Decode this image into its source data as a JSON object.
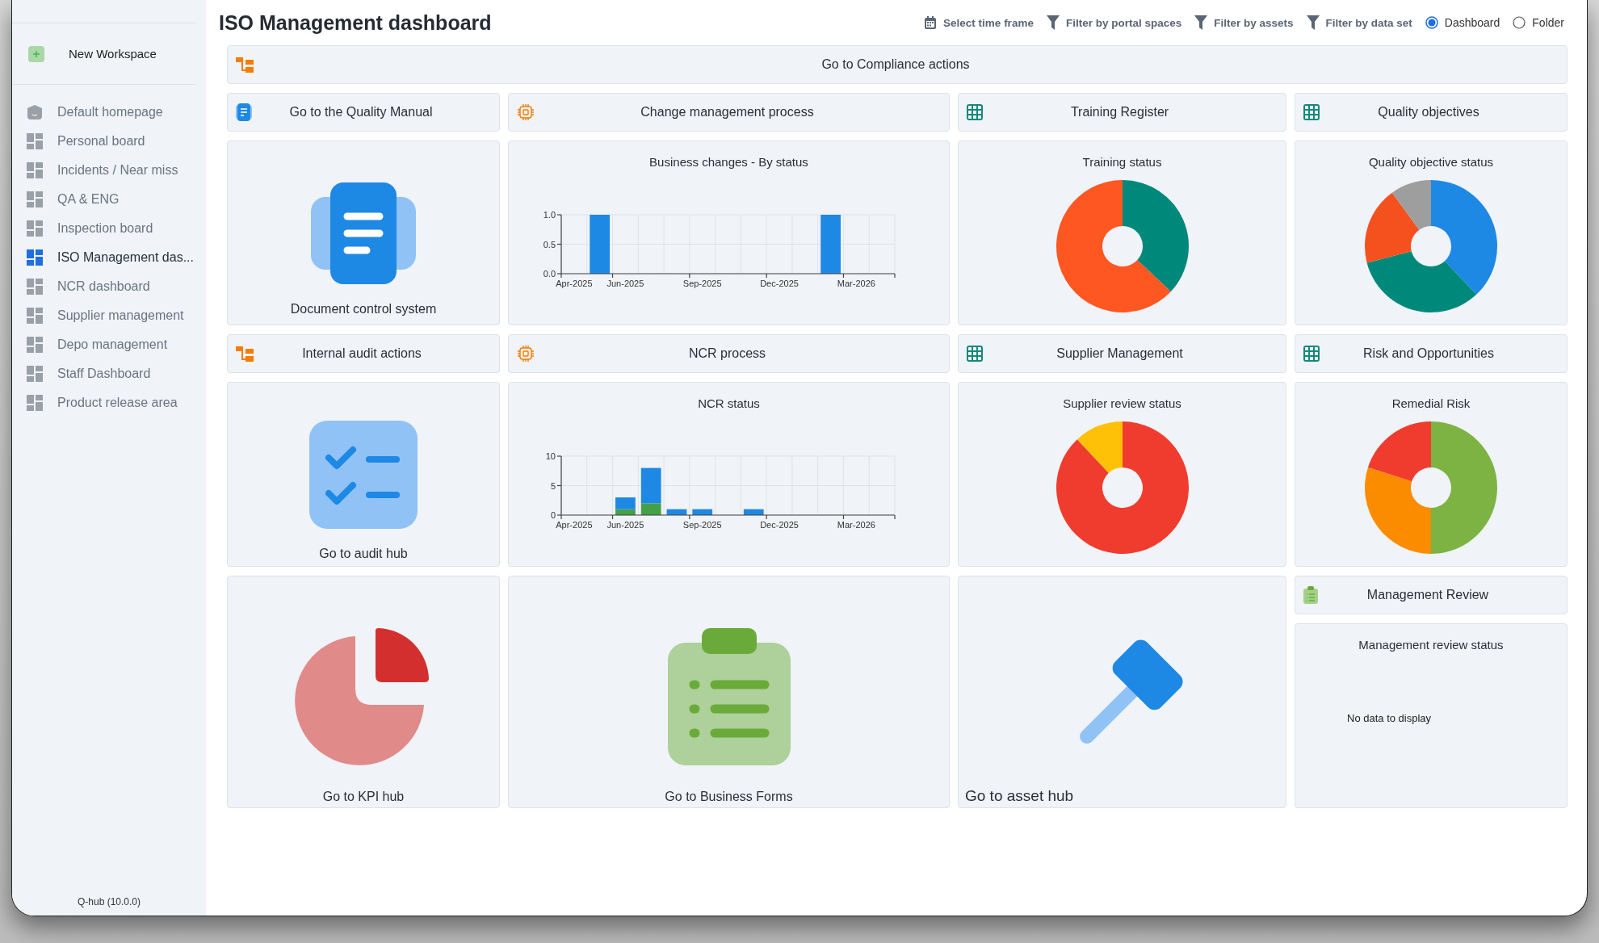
{
  "sidebar": {
    "new_workspace": "New Workspace",
    "items": [
      {
        "label": "Default homepage",
        "kind": "home",
        "selected": false
      },
      {
        "label": "Personal board",
        "kind": "board",
        "selected": false
      },
      {
        "label": "Incidents / Near miss",
        "kind": "board",
        "selected": false
      },
      {
        "label": "QA & ENG",
        "kind": "board",
        "selected": false
      },
      {
        "label": "Inspection board",
        "kind": "board",
        "selected": false
      },
      {
        "label": "ISO Management das...",
        "kind": "board",
        "selected": true
      },
      {
        "label": "NCR dashboard",
        "kind": "board",
        "selected": false
      },
      {
        "label": "Supplier management",
        "kind": "board",
        "selected": false
      },
      {
        "label": "Depo management",
        "kind": "board",
        "selected": false
      },
      {
        "label": "Staff Dashboard",
        "kind": "board",
        "selected": false
      },
      {
        "label": "Product release area",
        "kind": "board",
        "selected": false
      }
    ],
    "version": "Q-hub (10.0.0)"
  },
  "header": {
    "title": "ISO Management dashboard",
    "filters": [
      {
        "label": "Select time frame",
        "kind": "calendar"
      },
      {
        "label": "Filter by portal spaces",
        "kind": "funnel"
      },
      {
        "label": "Filter by assets",
        "kind": "funnel"
      },
      {
        "label": "Filter by data set",
        "kind": "funnel"
      }
    ],
    "view_options": [
      {
        "label": "Dashboard",
        "selected": true
      },
      {
        "label": "Folder",
        "selected": false
      }
    ]
  },
  "tiles": [
    {
      "kind": "actions",
      "title": "Go to Compliance actions"
    },
    {
      "kind": "manual",
      "title": "Go to the Quality Manual"
    },
    {
      "kind": "process",
      "title": "Change management process"
    },
    {
      "kind": "register",
      "title": "Training Register"
    },
    {
      "kind": "register",
      "title": "Quality objectives"
    },
    {
      "kind": "document_hub",
      "caption": "Document control system"
    },
    {
      "kind": "chart",
      "title": "Business changes - By status",
      "chart_data": {
        "type": "bar",
        "categories": [
          "Apr-2025",
          null,
          "Jun-2025",
          null,
          null,
          "Sep-2025",
          null,
          null,
          "Dec-2025",
          null,
          null,
          "Mar-2026",
          null
        ],
        "ylim": [
          0,
          1
        ],
        "yticks": [
          {
            "value": 0,
            "label": "0.0"
          },
          {
            "value": 0.5,
            "label": "0.5"
          },
          {
            "value": 1,
            "label": "1.0"
          }
        ],
        "stacked": true,
        "series": [
          {
            "color": "#1e88e5",
            "values": [
              0,
              1,
              0,
              0,
              0,
              0,
              0,
              0,
              0,
              0,
              1,
              0,
              0
            ]
          }
        ]
      }
    },
    {
      "kind": "donut",
      "title": "Training status"
    },
    {
      "kind": "donut",
      "title": "Quality objective status"
    },
    {
      "kind": "actions",
      "title": "Internal audit actions"
    },
    {
      "kind": "process",
      "title": "NCR process"
    },
    {
      "kind": "register",
      "title": "Supplier Management"
    },
    {
      "kind": "register",
      "title": "Risk and Opportunities"
    },
    {
      "kind": "audit_hub",
      "caption": "Go to audit hub"
    },
    {
      "kind": "chart",
      "title": "NCR status",
      "chart_data": {
        "type": "bar",
        "categories": [
          "Apr-2025",
          null,
          "Jun-2025",
          null,
          null,
          "Sep-2025",
          null,
          null,
          "Dec-2025",
          null,
          null,
          "Mar-2026",
          null
        ],
        "ylim": [
          0,
          10
        ],
        "yticks": [
          0,
          5,
          10
        ],
        "stacked": true,
        "series": [
          {
            "color": "#43a047",
            "values": [
              0,
              0,
              1,
              2,
              0,
              0,
              0,
              0,
              0,
              0,
              0,
              0,
              0
            ]
          },
          {
            "color": "#1e88e5",
            "values": [
              0,
              0,
              2,
              6,
              1,
              1,
              0,
              1,
              0,
              0,
              0,
              0,
              0
            ]
          }
        ]
      }
    },
    {
      "kind": "donut",
      "title": "Supplier review status"
    },
    {
      "kind": "donut",
      "title": "Remedial Risk"
    },
    {
      "kind": "kpi_hub",
      "caption": "Go to KPI hub"
    },
    {
      "kind": "forms_hub",
      "caption": "Go to Business Forms"
    },
    {
      "kind": "asset_hub",
      "caption": "Go to asset hub"
    },
    {
      "kind": "form",
      "title": "Management Review"
    },
    {
      "kind": "empty",
      "title": "Management review status",
      "message": "No data to display"
    }
  ]
}
